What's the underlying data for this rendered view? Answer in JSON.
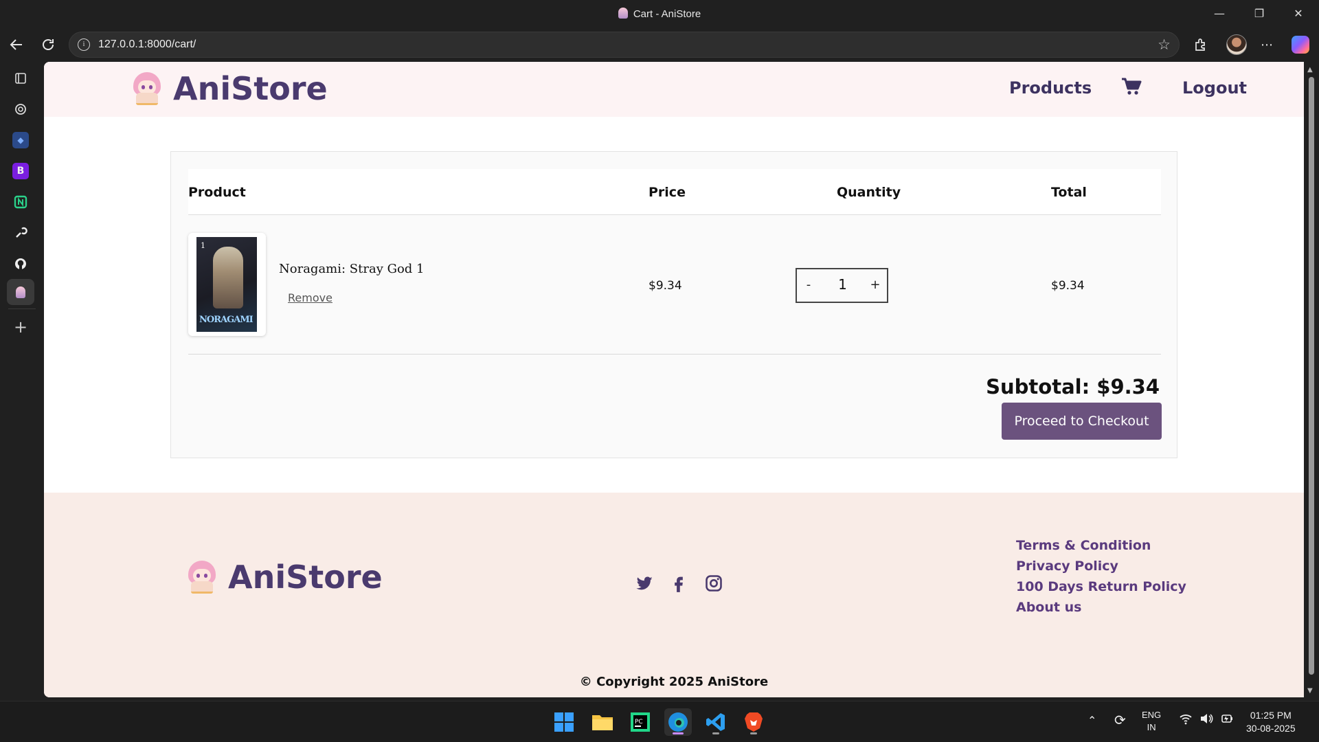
{
  "window": {
    "title": "Cart - AniStore",
    "minimize": "—",
    "maximize": "❐",
    "close": "✕"
  },
  "browser": {
    "url": "127.0.0.1:8000/cart/",
    "info_glyph": "i"
  },
  "site": {
    "brand": "AniStore",
    "nav": {
      "products": "Products",
      "logout": "Logout"
    }
  },
  "cart": {
    "headers": {
      "product": "Product",
      "price": "Price",
      "quantity": "Quantity",
      "total": "Total"
    },
    "items": [
      {
        "name": "Noragami: Stray God 1",
        "remove_label": "Remove",
        "price": "$9.34",
        "quantity": "1",
        "total": "$9.34",
        "cover_title": "NORAGAMI",
        "cover_number": "1"
      }
    ],
    "qty_minus": "-",
    "qty_plus": "+",
    "subtotal": "Subtotal: $9.34",
    "checkout_label": "Proceed to Checkout"
  },
  "footer": {
    "brand": "AniStore",
    "social": [
      "twitter-icon",
      "facebook-icon",
      "instagram-icon"
    ],
    "links": [
      "Terms & Condition",
      "Privacy Policy",
      "100 Days Return Policy",
      "About us"
    ],
    "copyright": "© Copyright 2025 AniStore"
  },
  "taskbar": {
    "lang_top": "ENG",
    "lang_bottom": "IN",
    "time": "01:25 PM",
    "date": "30-08-2025"
  },
  "colors": {
    "brand_purple": "#4a3a6e",
    "checkout_bg": "#6b527e",
    "header_bg": "#fdf3f4",
    "footer_bg": "#f9ece7",
    "link_purple": "#5a3a7e"
  }
}
